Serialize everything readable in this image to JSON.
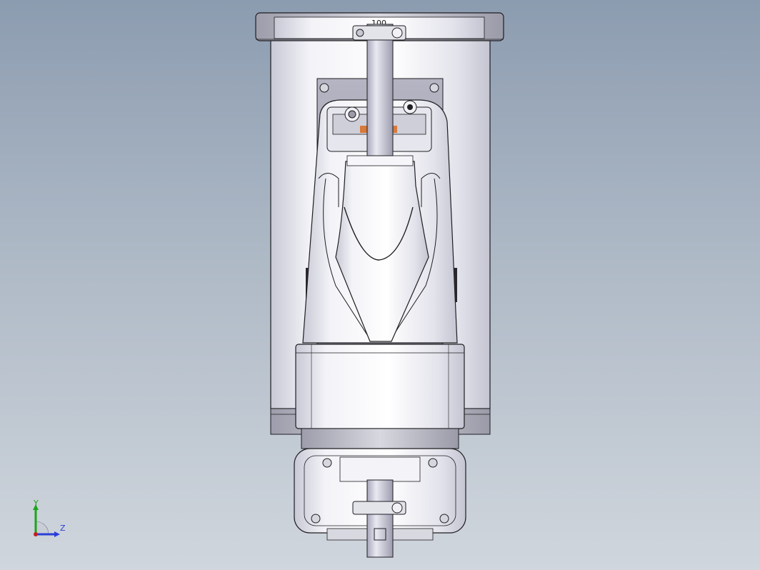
{
  "viewport": {
    "background_top": "#8c9cb0",
    "background_bottom": "#d0d6dd",
    "part_fill": "#e9e9ef",
    "edge_color": "#1e1e22",
    "accent_orange": "#d9793a"
  },
  "model": {
    "top_label": "100"
  },
  "triad": {
    "y_label": "Y",
    "z_label": "Z",
    "y_color": "#1aa51a",
    "z_color": "#2a3fd8",
    "x_color": "#c81e1e"
  }
}
